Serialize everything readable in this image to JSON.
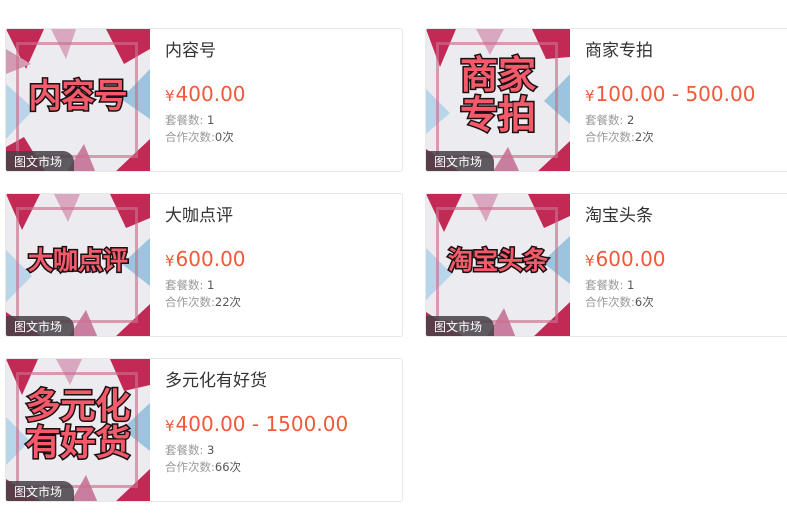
{
  "currency_symbol": "¥",
  "cards": [
    {
      "thumb_lines": [
        "内容号"
      ],
      "thumb_tag": "图文市场",
      "title": "内容号",
      "price": "400.00",
      "packages_label": "套餐数:",
      "packages": "1",
      "coop_label": "合作次数:",
      "coop": "0次"
    },
    {
      "thumb_lines": [
        "商家",
        "专拍"
      ],
      "thumb_tag": "图文市场",
      "title": "商家专拍",
      "price": "100.00 - 500.00",
      "packages_label": "套餐数:",
      "packages": "2",
      "coop_label": "合作次数:",
      "coop": "2次"
    },
    {
      "thumb_lines": [
        "大咖点评"
      ],
      "thumb_tag": "图文市场",
      "title": "大咖点评",
      "price": "600.00",
      "packages_label": "套餐数:",
      "packages": "1",
      "coop_label": "合作次数:",
      "coop": "22次"
    },
    {
      "thumb_lines": [
        "淘宝头条"
      ],
      "thumb_tag": "图文市场",
      "title": "淘宝头条",
      "price": "600.00",
      "packages_label": "套餐数:",
      "packages": "1",
      "coop_label": "合作次数:",
      "coop": "6次"
    },
    {
      "thumb_lines": [
        "多元化",
        "有好货"
      ],
      "thumb_tag": "图文市场",
      "title": "多元化有好货",
      "price": "400.00 - 1500.00",
      "packages_label": "套餐数:",
      "packages": "3",
      "coop_label": "合作次数:",
      "coop": "66次"
    }
  ]
}
